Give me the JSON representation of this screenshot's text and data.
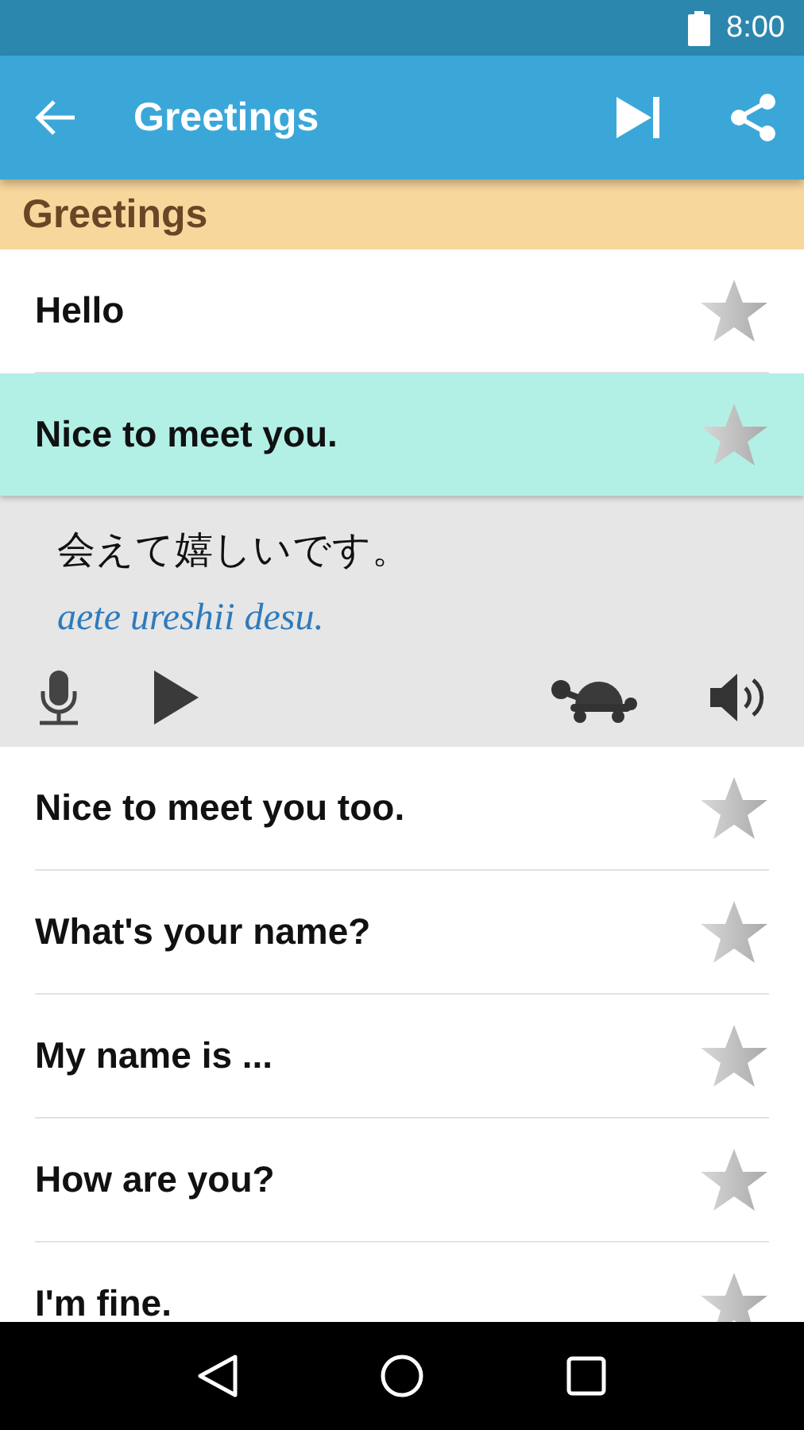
{
  "status_bar": {
    "time": "8:00"
  },
  "app_bar": {
    "title": "Greetings"
  },
  "section": {
    "title": "Greetings"
  },
  "phrases": [
    {
      "text": "Hello",
      "selected": false,
      "starred": false
    },
    {
      "text": "Nice to meet you.",
      "selected": true,
      "starred": false,
      "translation": "会えて嬉しいです。",
      "romaji": "aete ureshii desu."
    },
    {
      "text": "Nice to meet you too.",
      "selected": false,
      "starred": false
    },
    {
      "text": "What's your name?",
      "selected": false,
      "starred": false
    },
    {
      "text": "My name is ...",
      "selected": false,
      "starred": false
    },
    {
      "text": "How are you?",
      "selected": false,
      "starred": false
    },
    {
      "text": "I'm fine.",
      "selected": false,
      "starred": false
    }
  ]
}
